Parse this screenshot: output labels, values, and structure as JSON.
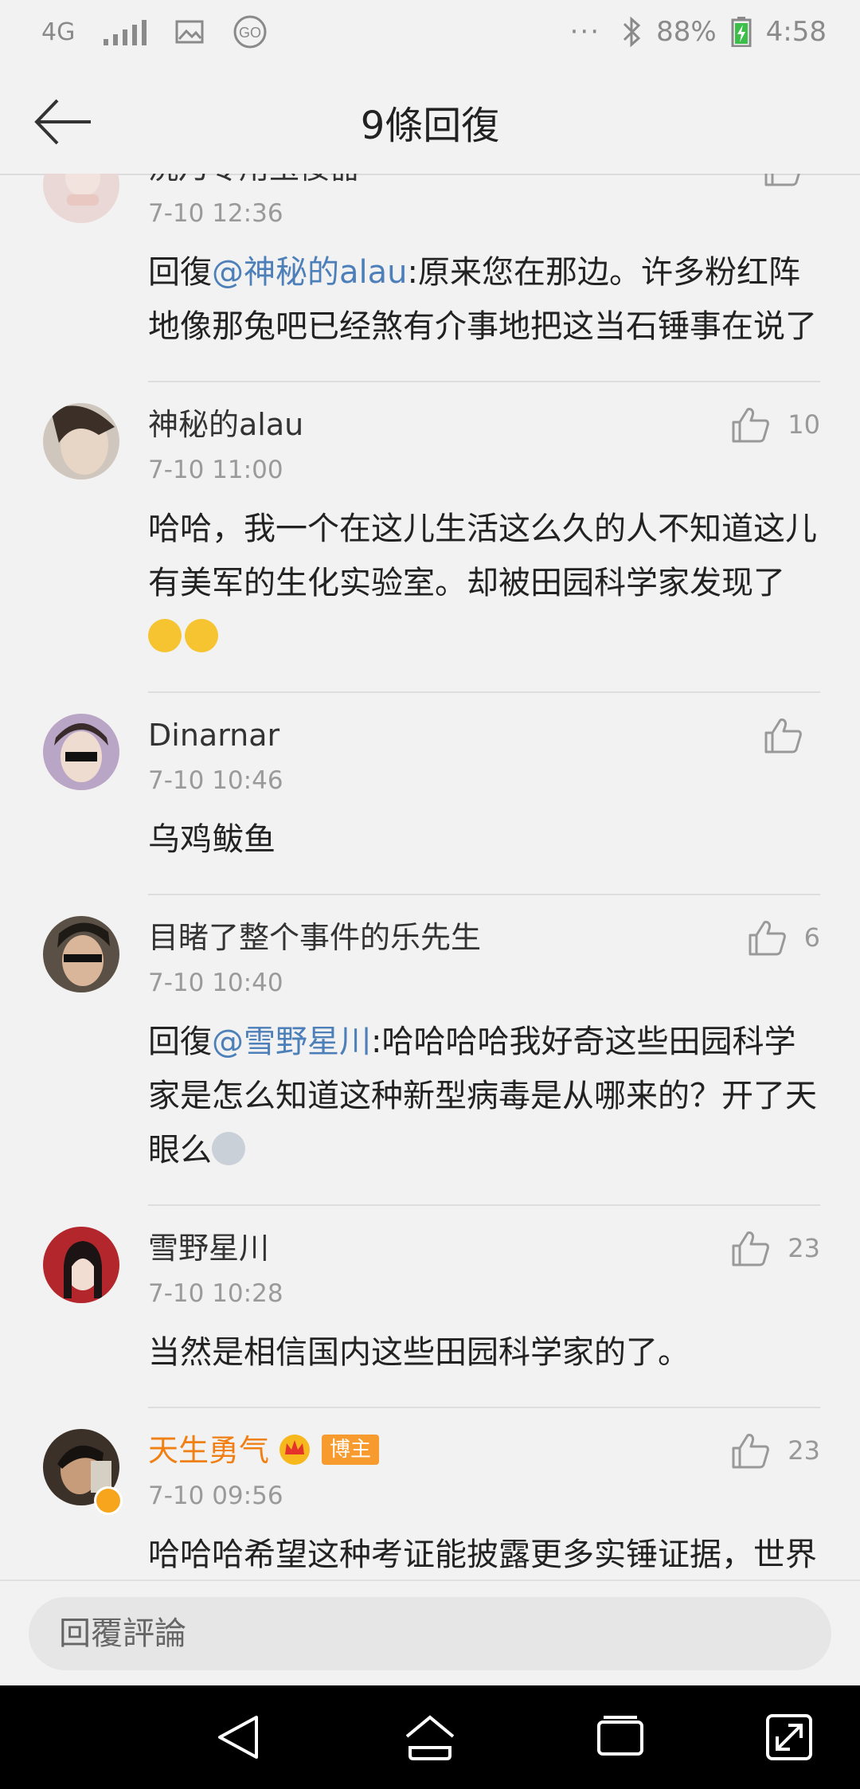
{
  "status_bar": {
    "network": "4G",
    "dots": "···",
    "battery": "88%",
    "time": "4:58"
  },
  "header": {
    "title": "9條回復"
  },
  "comments": [
    {
      "name": "洸乃专用玉佞器",
      "likes": "",
      "time": "7-10 12:36",
      "text_pre": "回復",
      "mention": "@神秘的alau",
      "text": ":原来您在那边。许多粉红阵地像那兔吧已经煞有介事地把这当石锤事在说了"
    },
    {
      "name": "神秘的alau",
      "likes": "10",
      "time": "7-10 11:00",
      "text": "哈哈，我一个在这儿生活这么久的人不知道这儿有美军的生化实验室。却被田园科学家发现了"
    },
    {
      "name": "Dinarnar",
      "likes": "",
      "time": "7-10 10:46",
      "text": "乌鸡鲅鱼"
    },
    {
      "name": "目睹了整个事件的乐先生",
      "likes": "6",
      "time": "7-10 10:40",
      "text_pre": "回復",
      "mention": "@雪野星川",
      "text": ":哈哈哈哈我好奇这些田园科学家是怎么知道这种新型病毒是从哪来的？开了天眼么"
    },
    {
      "name": "雪野星川",
      "likes": "23",
      "time": "7-10 10:28",
      "text": "当然是相信国内这些田园科学家的了。"
    },
    {
      "name": "天生勇气",
      "badge": "博主",
      "likes": "23",
      "time": "7-10 09:56",
      "text": "哈哈哈希望这种考证能披露更多实锤证据，世界从来不缺阴谋论嘛，包括我在内都对阴谋论"
    }
  ],
  "reply": {
    "placeholder": "回覆評論"
  },
  "colors": {
    "mention": "#4d7fb9",
    "vip_name": "#f07f14",
    "badge": "#f79b2e"
  }
}
